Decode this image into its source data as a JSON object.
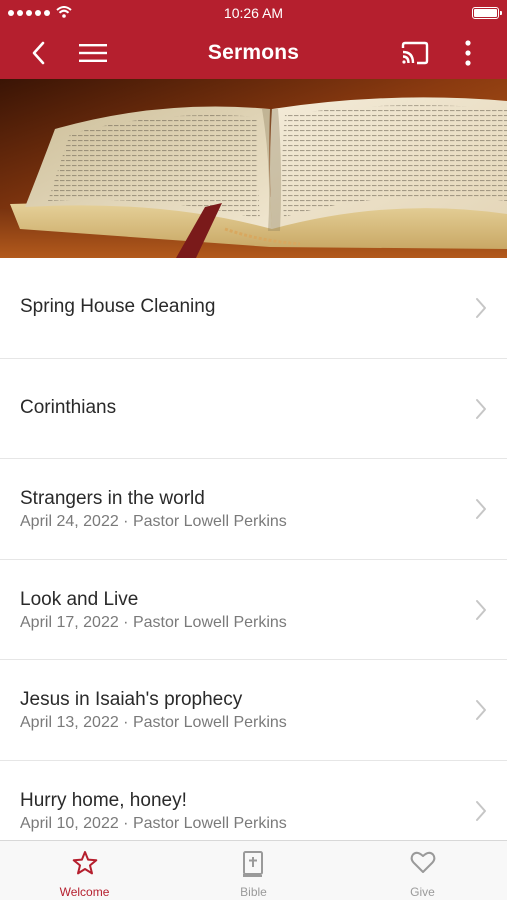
{
  "status_bar": {
    "time": "10:26 AM"
  },
  "header": {
    "title": "Sermons",
    "color": "#b51f2e"
  },
  "hero": {
    "icon": "open-bible-photo"
  },
  "sermons": [
    {
      "title": "Spring House Cleaning",
      "subtitle": ""
    },
    {
      "title": "Corinthians",
      "subtitle": ""
    },
    {
      "title": "Strangers in the world",
      "subtitle": "April 24, 2022 · Pastor Lowell Perkins"
    },
    {
      "title": "Look and Live",
      "subtitle": "April 17, 2022 · Pastor Lowell Perkins"
    },
    {
      "title": "Jesus in Isaiah's prophecy",
      "subtitle": "April 13, 2022 · Pastor Lowell Perkins"
    },
    {
      "title": "Hurry home, honey!",
      "subtitle": "April 10, 2022 · Pastor Lowell Perkins"
    }
  ],
  "tabs": [
    {
      "label": "Welcome",
      "icon": "star-icon",
      "active": true
    },
    {
      "label": "Bible",
      "icon": "bible-icon",
      "active": false
    },
    {
      "label": "Give",
      "icon": "heart-icon",
      "active": false
    }
  ]
}
